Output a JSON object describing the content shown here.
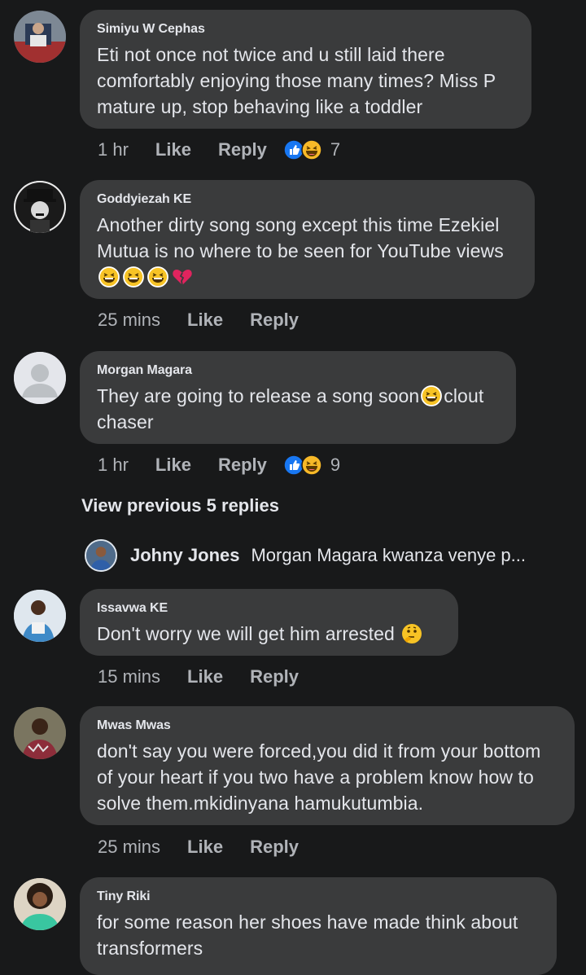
{
  "comments": [
    {
      "name": "Simiyu W Cephas",
      "text": "Eti not once not twice and u still laid there comfortably enjoying those many times? Miss P mature up, stop behaving like a toddler",
      "time": "1 hr",
      "like_label": "Like",
      "reply_label": "Reply",
      "reactions": [
        "like-reaction-icon",
        "haha-reaction-icon"
      ],
      "reaction_count": "7"
    },
    {
      "name": "Goddyiezah KE",
      "text": "Another dirty song song except this time Ezekiel Mutua is no where to be seen for YouTube views",
      "text_emojis": [
        "tears-of-joy-emoji",
        "tears-of-joy-emoji",
        "tears-of-joy-emoji",
        "broken-heart-emoji"
      ],
      "time": "25 mins",
      "like_label": "Like",
      "reply_label": "Reply"
    },
    {
      "name": "Morgan Magara",
      "text_before": "They are going to release a song soon",
      "text_after": "clout chaser",
      "time": "1 hr",
      "like_label": "Like",
      "reply_label": "Reply",
      "reactions": [
        "like-reaction-icon",
        "haha-reaction-icon"
      ],
      "reaction_count": "9"
    },
    {
      "name": "Issavwa KE",
      "text": "Don't worry we will get him arrested",
      "time": "15 mins",
      "like_label": "Like",
      "reply_label": "Reply"
    },
    {
      "name": "Mwas Mwas",
      "text": "don't say you were forced,you did it from your bottom of your heart if you two have a problem know how to solve them.mkidinyana hamukutumbia.",
      "time": "25 mins",
      "like_label": "Like",
      "reply_label": "Reply"
    },
    {
      "name": "Tiny Riki",
      "text": "for some reason her shoes have made think about transformers"
    }
  ],
  "view_previous": "View previous 5 replies",
  "reply_preview": {
    "name": "Johny Jones",
    "text": "Morgan Magara kwanza venye p..."
  },
  "colors": {
    "background": "#18191a",
    "bubble": "#3a3b3c",
    "text": "#e4e6eb",
    "secondary": "#b0b3b8",
    "like_blue": "#1877f2",
    "haha_yellow": "#f7b928"
  }
}
